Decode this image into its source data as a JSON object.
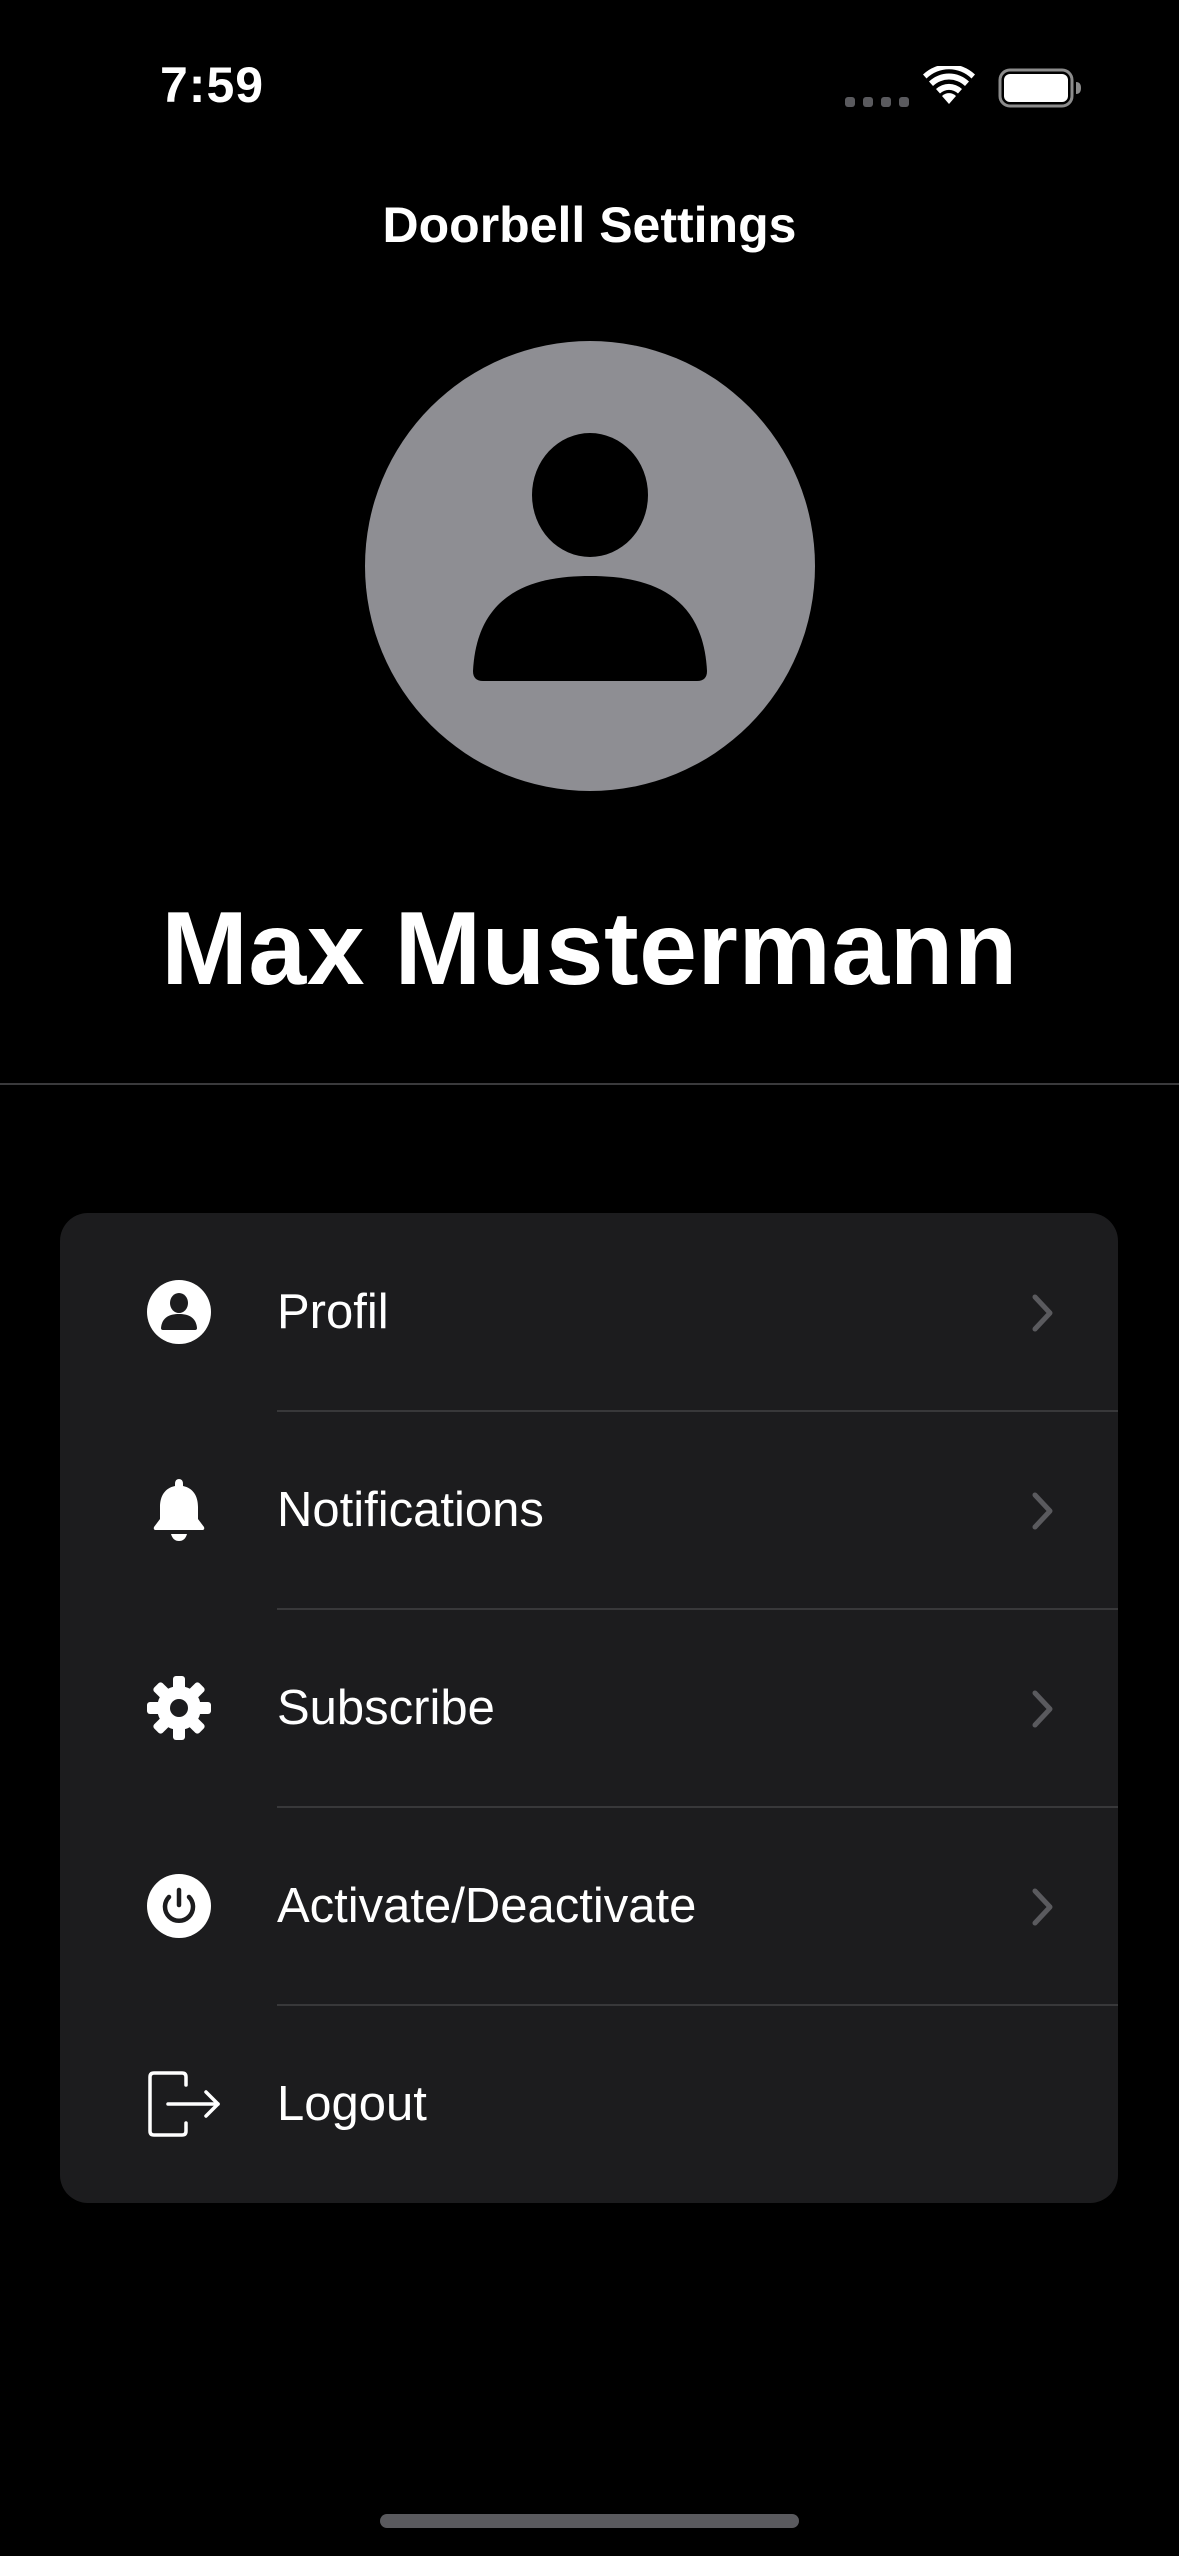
{
  "status_bar": {
    "time": "7:59",
    "wifi_icon": "wifi-icon",
    "battery_icon": "battery-icon"
  },
  "nav": {
    "title": "Doorbell Settings"
  },
  "profile": {
    "avatar_icon": "person-silhouette-icon",
    "name": "Max Mustermann"
  },
  "menu": {
    "items": [
      {
        "label": "Profil",
        "icon": "person-circle-icon",
        "has_chevron": true
      },
      {
        "label": "Notifications",
        "icon": "bell-icon",
        "has_chevron": true
      },
      {
        "label": "Subscribe",
        "icon": "gear-icon",
        "has_chevron": true
      },
      {
        "label": "Activate/Deactivate",
        "icon": "power-icon",
        "has_chevron": true
      },
      {
        "label": "Logout",
        "icon": "logout-icon",
        "has_chevron": false
      }
    ]
  },
  "colors": {
    "background": "#000000",
    "card": "#1c1c1e",
    "avatar": "#8e8e93",
    "text": "#ffffff",
    "chevron": "#5a5a5e"
  }
}
